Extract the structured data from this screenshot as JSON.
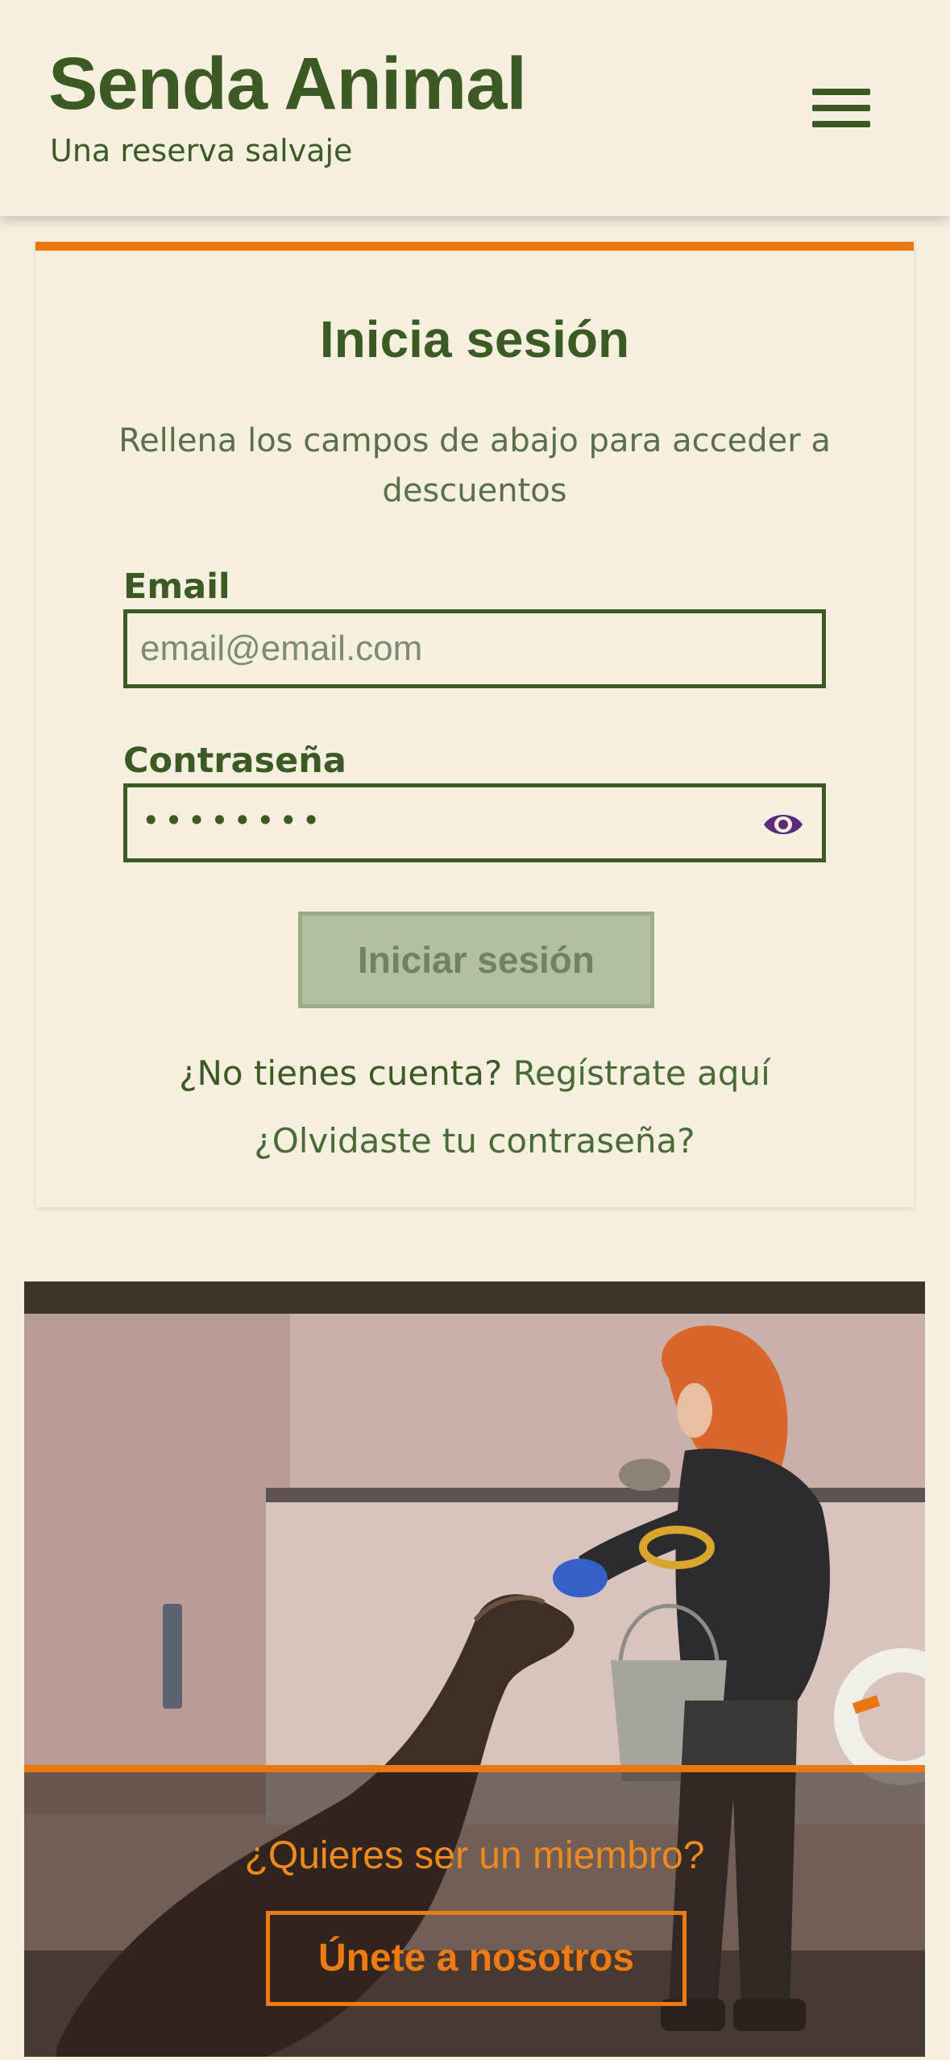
{
  "header": {
    "title": "Senda Animal",
    "subtitle": "Una reserva salvaje",
    "menu_icon": "hamburger-menu-icon"
  },
  "login": {
    "title": "Inicia sesión",
    "description": "Rellena los campos de abajo para acceder a descuentos",
    "email_label": "Email",
    "email_placeholder": "email@email.com",
    "email_value": "",
    "password_label": "Contraseña",
    "password_value": "••••••••",
    "show_password_icon": "eye-icon",
    "submit_label": "Iniciar sesión",
    "no_account_text": "¿No tienes cuenta?",
    "register_link": "Regístrate aquí",
    "forgot_link": "¿Olvidaste tu contraseña?"
  },
  "membership": {
    "question": "¿Quieres ser un miembro?",
    "join_label": "Únete a nosotros"
  },
  "colors": {
    "background": "#f6f0e0",
    "primary_green": "#3b5a24",
    "accent_orange": "#e8780f",
    "disabled_button": "#b3c0a0",
    "eye_icon": "#5b2a7a"
  }
}
